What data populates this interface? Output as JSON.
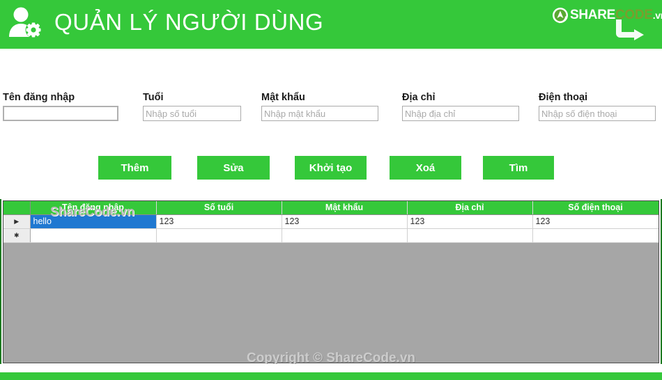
{
  "header": {
    "title": "QUẢN LÝ NGƯỜI DÙNG",
    "icon": "user-gear-icon",
    "background_color": "#35c83a",
    "brand": {
      "mark": "sharecode-logo-icon",
      "part1": "SHARE",
      "part2": "CODE",
      "part3": ".vn",
      "part1_color": "#ffffff",
      "part2_color": "#7a9e2e",
      "part3_color": "#ffffff"
    }
  },
  "form": {
    "fields": [
      {
        "label": "Tên đăng nhập",
        "value": "",
        "placeholder": "",
        "name": "username"
      },
      {
        "label": "Tuổi",
        "value": "",
        "placeholder": "Nhập số tuổi",
        "name": "age"
      },
      {
        "label": "Mật khẩu",
        "value": "",
        "placeholder": "Nhập mật khẩu",
        "name": "password"
      },
      {
        "label": "Địa chỉ",
        "value": "",
        "placeholder": "Nhập địa chỉ",
        "name": "address"
      },
      {
        "label": "Điện thoại",
        "value": "",
        "placeholder": "Nhập số điện thoại",
        "name": "phone"
      }
    ]
  },
  "buttons": [
    {
      "label": "Thêm",
      "name": "add"
    },
    {
      "label": "Sửa",
      "name": "edit"
    },
    {
      "label": "Khởi tạo",
      "name": "reset"
    },
    {
      "label": "Xoá",
      "name": "delete"
    },
    {
      "label": "Tìm",
      "name": "search"
    }
  ],
  "grid": {
    "columns": [
      "Tên đăng nhập",
      "Số tuổi",
      "Mật khẩu",
      "Địa chỉ",
      "Số điện thoại"
    ],
    "rows": [
      {
        "indicator": "▶",
        "cells": [
          "hello",
          "123",
          "123",
          "123",
          "123"
        ],
        "selected": true
      },
      {
        "indicator": "✱",
        "cells": [
          "",
          "",
          "",
          "",
          ""
        ],
        "selected": false
      }
    ],
    "header_color": "#35c83a",
    "selection_color": "#1f78d1"
  },
  "watermarks": {
    "grid": "ShareCode.vn",
    "copyright": "Copyright © ShareCode.vn"
  }
}
